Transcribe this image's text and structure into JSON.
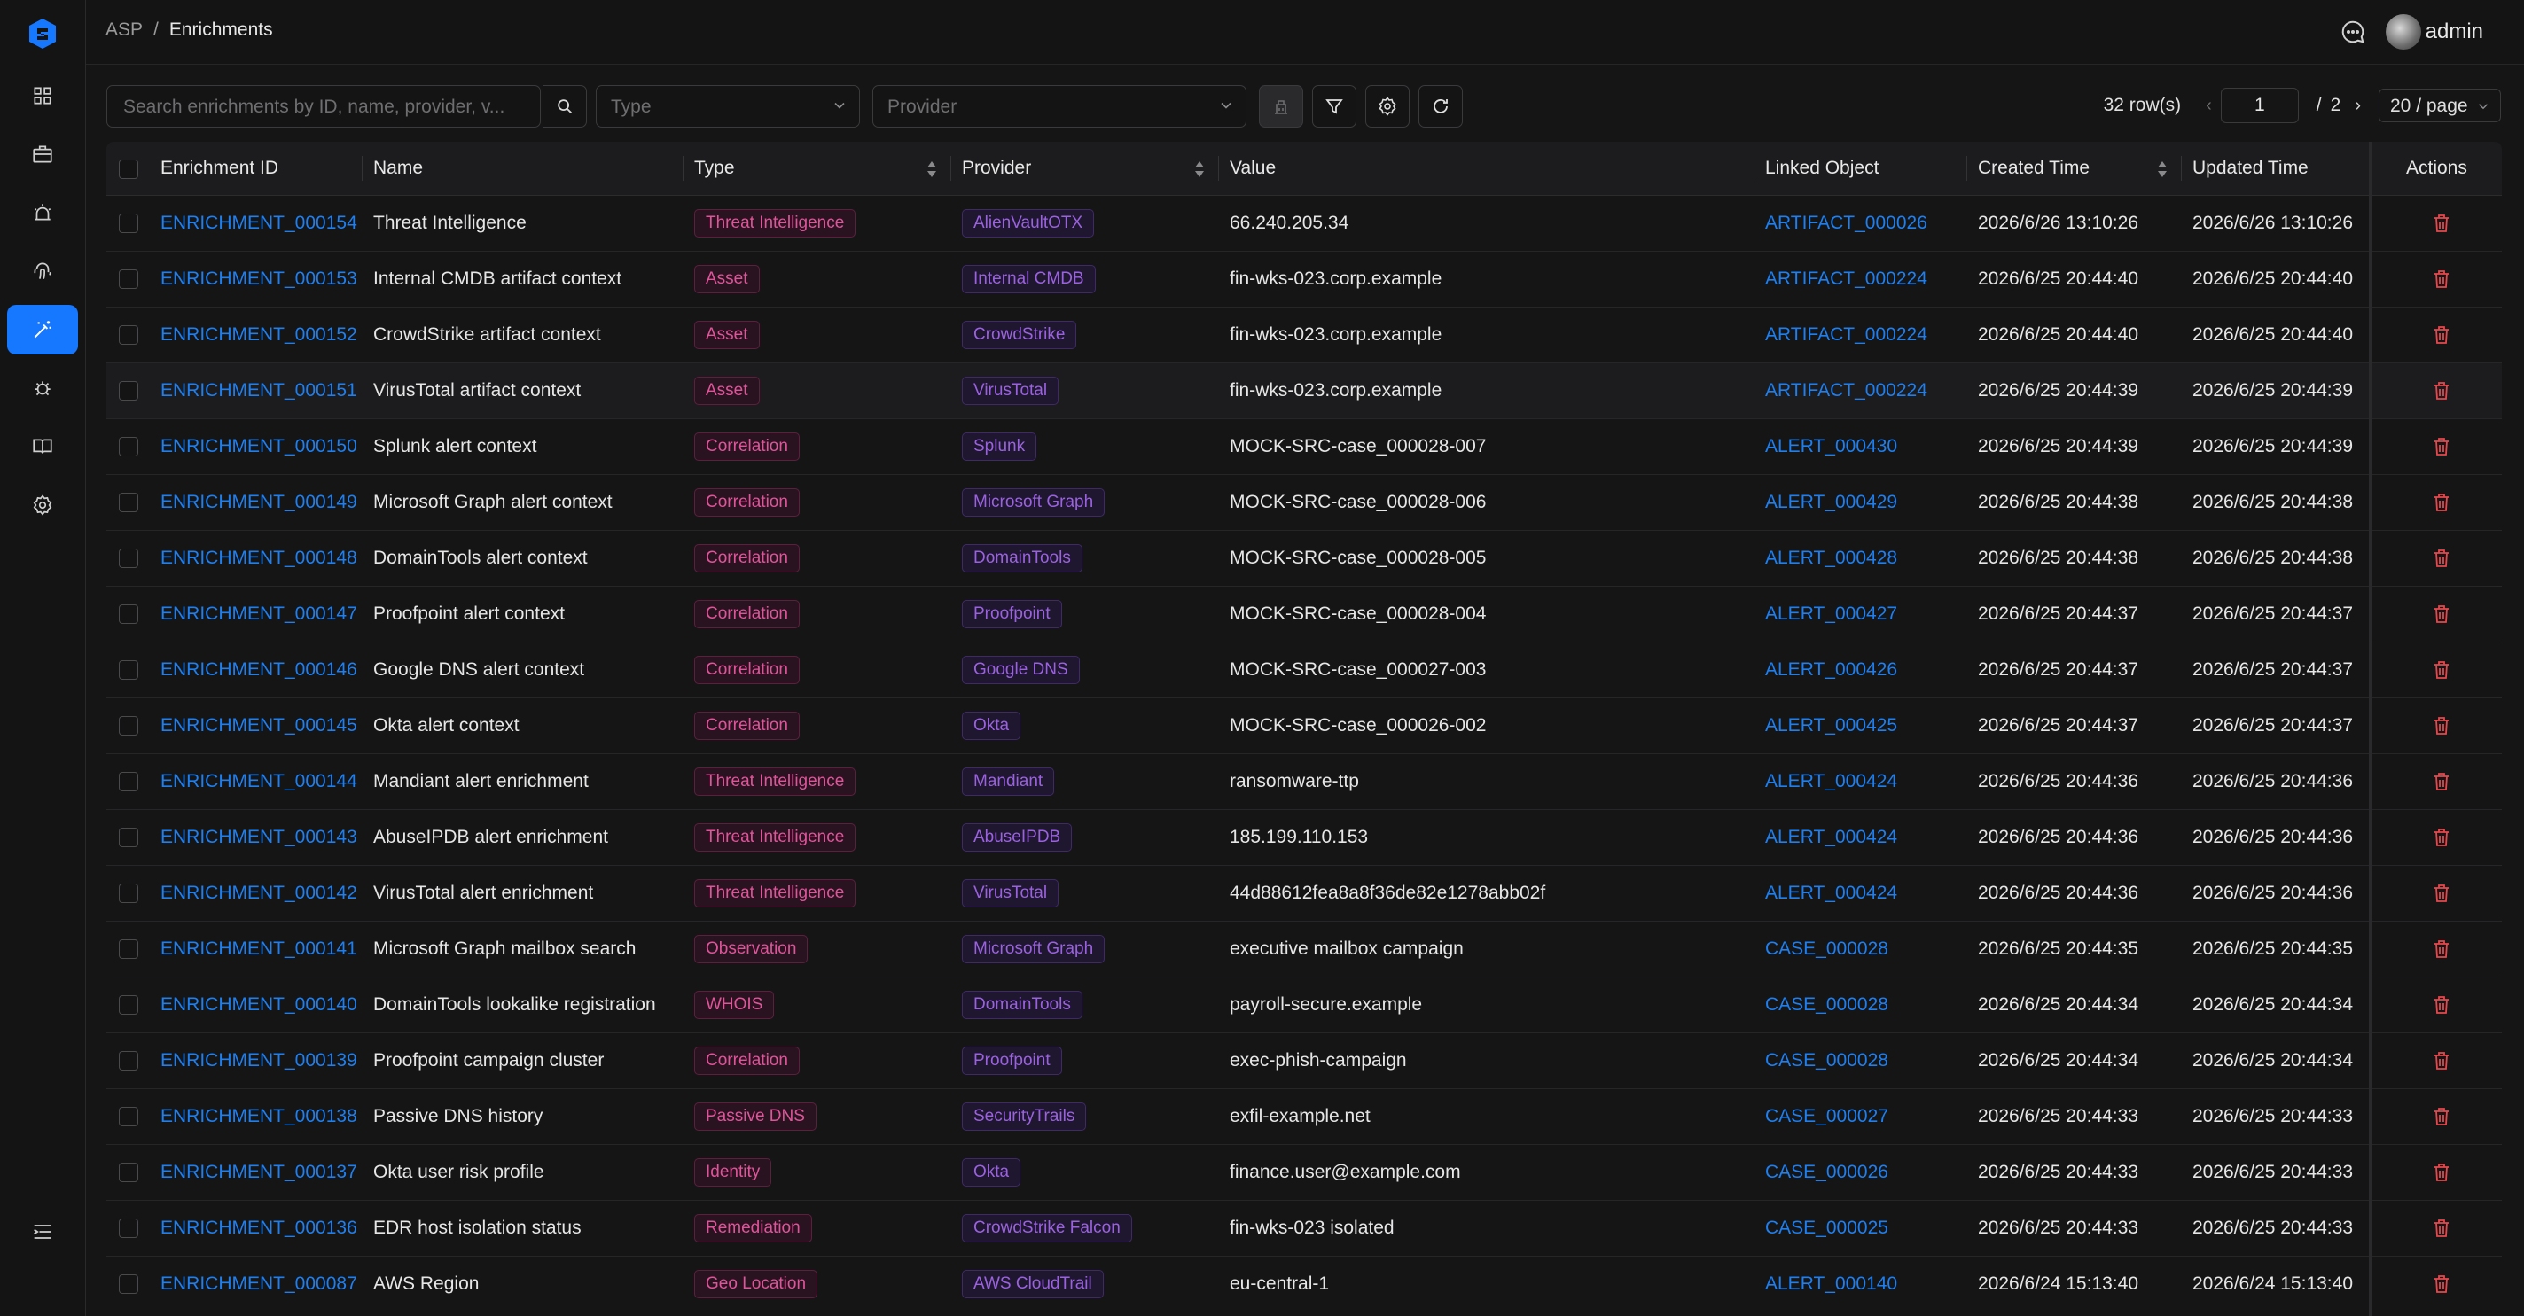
{
  "header": {
    "breadcrumb_root": "ASP",
    "breadcrumb_sep": "/",
    "breadcrumb_current": "Enrichments",
    "username": "admin"
  },
  "toolbar": {
    "search_placeholder": "Search enrichments by ID, name, provider, v...",
    "type_placeholder": "Type",
    "provider_placeholder": "Provider"
  },
  "pagination": {
    "row_count": "32 row(s)",
    "current_page": "1",
    "slash": "/",
    "total_pages": "2",
    "page_size": "20 / page"
  },
  "table": {
    "columns": {
      "id": "Enrichment ID",
      "name": "Name",
      "type": "Type",
      "provider": "Provider",
      "value": "Value",
      "linked": "Linked Object",
      "created": "Created Time",
      "updated": "Updated Time",
      "actions": "Actions"
    },
    "rows": [
      {
        "id": "ENRICHMENT_000154",
        "name": "Threat Intelligence",
        "type": "Threat Intelligence",
        "provider": "AlienVaultOTX",
        "value": "66.240.205.34",
        "linked": "ARTIFACT_000026",
        "created": "2026/6/26 13:10:26",
        "updated": "2026/6/26 13:10:26"
      },
      {
        "id": "ENRICHMENT_000153",
        "name": "Internal CMDB artifact context",
        "type": "Asset",
        "provider": "Internal CMDB",
        "value": "fin-wks-023.corp.example",
        "linked": "ARTIFACT_000224",
        "created": "2026/6/25 20:44:40",
        "updated": "2026/6/25 20:44:40"
      },
      {
        "id": "ENRICHMENT_000152",
        "name": "CrowdStrike artifact context",
        "type": "Asset",
        "provider": "CrowdStrike",
        "value": "fin-wks-023.corp.example",
        "linked": "ARTIFACT_000224",
        "created": "2026/6/25 20:44:40",
        "updated": "2026/6/25 20:44:40"
      },
      {
        "id": "ENRICHMENT_000151",
        "name": "VirusTotal artifact context",
        "type": "Asset",
        "provider": "VirusTotal",
        "value": "fin-wks-023.corp.example",
        "linked": "ARTIFACT_000224",
        "created": "2026/6/25 20:44:39",
        "updated": "2026/6/25 20:44:39"
      },
      {
        "id": "ENRICHMENT_000150",
        "name": "Splunk alert context",
        "type": "Correlation",
        "provider": "Splunk",
        "value": "MOCK-SRC-case_000028-007",
        "linked": "ALERT_000430",
        "created": "2026/6/25 20:44:39",
        "updated": "2026/6/25 20:44:39"
      },
      {
        "id": "ENRICHMENT_000149",
        "name": "Microsoft Graph alert context",
        "type": "Correlation",
        "provider": "Microsoft Graph",
        "value": "MOCK-SRC-case_000028-006",
        "linked": "ALERT_000429",
        "created": "2026/6/25 20:44:38",
        "updated": "2026/6/25 20:44:38"
      },
      {
        "id": "ENRICHMENT_000148",
        "name": "DomainTools alert context",
        "type": "Correlation",
        "provider": "DomainTools",
        "value": "MOCK-SRC-case_000028-005",
        "linked": "ALERT_000428",
        "created": "2026/6/25 20:44:38",
        "updated": "2026/6/25 20:44:38"
      },
      {
        "id": "ENRICHMENT_000147",
        "name": "Proofpoint alert context",
        "type": "Correlation",
        "provider": "Proofpoint",
        "value": "MOCK-SRC-case_000028-004",
        "linked": "ALERT_000427",
        "created": "2026/6/25 20:44:37",
        "updated": "2026/6/25 20:44:37"
      },
      {
        "id": "ENRICHMENT_000146",
        "name": "Google DNS alert context",
        "type": "Correlation",
        "provider": "Google DNS",
        "value": "MOCK-SRC-case_000027-003",
        "linked": "ALERT_000426",
        "created": "2026/6/25 20:44:37",
        "updated": "2026/6/25 20:44:37"
      },
      {
        "id": "ENRICHMENT_000145",
        "name": "Okta alert context",
        "type": "Correlation",
        "provider": "Okta",
        "value": "MOCK-SRC-case_000026-002",
        "linked": "ALERT_000425",
        "created": "2026/6/25 20:44:37",
        "updated": "2026/6/25 20:44:37"
      },
      {
        "id": "ENRICHMENT_000144",
        "name": "Mandiant alert enrichment",
        "type": "Threat Intelligence",
        "provider": "Mandiant",
        "value": "ransomware-ttp",
        "linked": "ALERT_000424",
        "created": "2026/6/25 20:44:36",
        "updated": "2026/6/25 20:44:36"
      },
      {
        "id": "ENRICHMENT_000143",
        "name": "AbuseIPDB alert enrichment",
        "type": "Threat Intelligence",
        "provider": "AbuseIPDB",
        "value": "185.199.110.153",
        "linked": "ALERT_000424",
        "created": "2026/6/25 20:44:36",
        "updated": "2026/6/25 20:44:36"
      },
      {
        "id": "ENRICHMENT_000142",
        "name": "VirusTotal alert enrichment",
        "type": "Threat Intelligence",
        "provider": "VirusTotal",
        "value": "44d88612fea8a8f36de82e1278abb02f",
        "linked": "ALERT_000424",
        "created": "2026/6/25 20:44:36",
        "updated": "2026/6/25 20:44:36"
      },
      {
        "id": "ENRICHMENT_000141",
        "name": "Microsoft Graph mailbox search",
        "type": "Observation",
        "provider": "Microsoft Graph",
        "value": "executive mailbox campaign",
        "linked": "CASE_000028",
        "created": "2026/6/25 20:44:35",
        "updated": "2026/6/25 20:44:35"
      },
      {
        "id": "ENRICHMENT_000140",
        "name": "DomainTools lookalike registration",
        "type": "WHOIS",
        "provider": "DomainTools",
        "value": "payroll-secure.example",
        "linked": "CASE_000028",
        "created": "2026/6/25 20:44:34",
        "updated": "2026/6/25 20:44:34"
      },
      {
        "id": "ENRICHMENT_000139",
        "name": "Proofpoint campaign cluster",
        "type": "Correlation",
        "provider": "Proofpoint",
        "value": "exec-phish-campaign",
        "linked": "CASE_000028",
        "created": "2026/6/25 20:44:34",
        "updated": "2026/6/25 20:44:34"
      },
      {
        "id": "ENRICHMENT_000138",
        "name": "Passive DNS history",
        "type": "Passive DNS",
        "provider": "SecurityTrails",
        "value": "exfil-example.net",
        "linked": "CASE_000027",
        "created": "2026/6/25 20:44:33",
        "updated": "2026/6/25 20:44:33"
      },
      {
        "id": "ENRICHMENT_000137",
        "name": "Okta user risk profile",
        "type": "Identity",
        "provider": "Okta",
        "value": "finance.user@example.com",
        "linked": "CASE_000026",
        "created": "2026/6/25 20:44:33",
        "updated": "2026/6/25 20:44:33"
      },
      {
        "id": "ENRICHMENT_000136",
        "name": "EDR host isolation status",
        "type": "Remediation",
        "provider": "CrowdStrike Falcon",
        "value": "fin-wks-023 isolated",
        "linked": "CASE_000025",
        "created": "2026/6/25 20:44:33",
        "updated": "2026/6/25 20:44:33"
      },
      {
        "id": "ENRICHMENT_000087",
        "name": "AWS Region",
        "type": "Geo Location",
        "provider": "AWS CloudTrail",
        "value": "eu-central-1",
        "linked": "ALERT_000140",
        "created": "2026/6/24 15:13:40",
        "updated": "2026/6/24 15:13:40"
      }
    ]
  },
  "colors": {
    "accent": "#1677ff",
    "link": "#1e7ff0",
    "type_tag": "#e0549a",
    "provider_tag": "#9b62e0",
    "delete": "#e5484d"
  }
}
